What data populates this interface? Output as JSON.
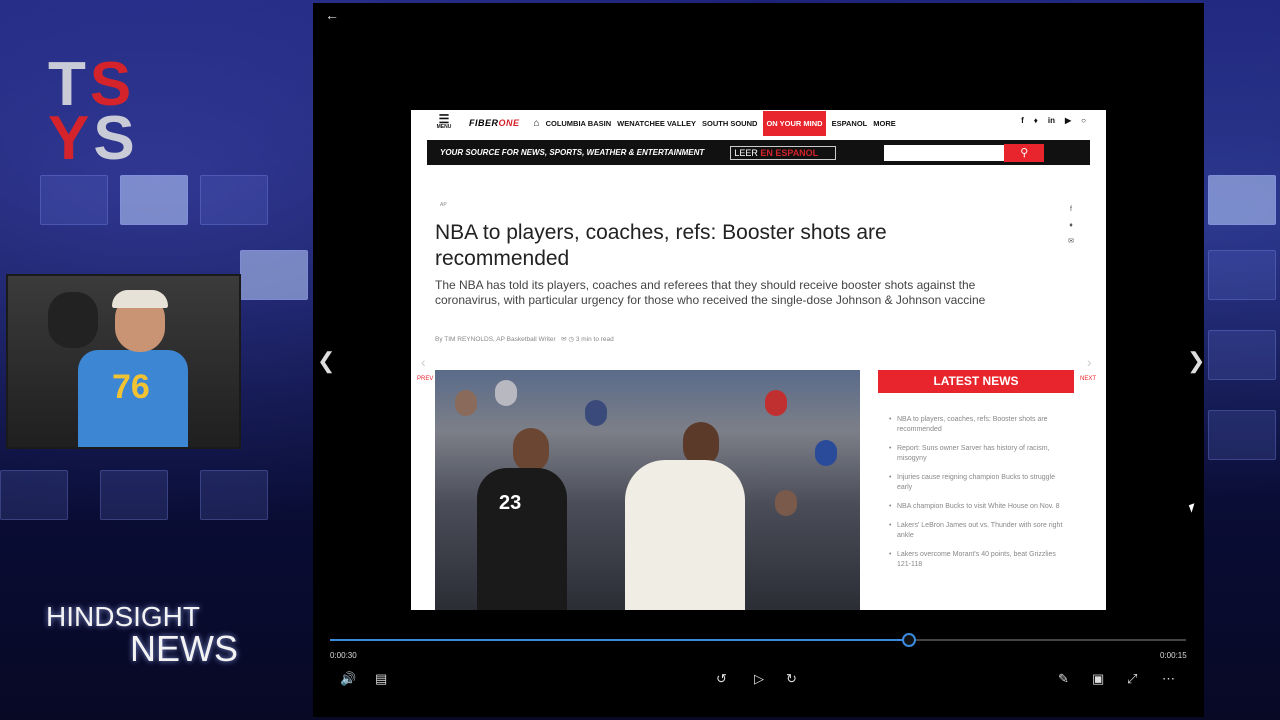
{
  "overlay": {
    "logo_line1_a": "T",
    "logo_line1_b": "S",
    "logo_line2_a": "Y",
    "logo_line2_b": "S",
    "show_word1": "HINDSIGHT",
    "show_word2": "NEWS",
    "shirt_number": "76"
  },
  "site": {
    "menu_label": "MENU",
    "brand_a": "FIBER",
    "brand_b": "ONE",
    "nav": [
      "COLUMBIA BASIN",
      "WENATCHEE VALLEY",
      "SOUTH SOUND",
      "ON YOUR MIND",
      "ESPANOL",
      "MORE"
    ],
    "tagline": "YOUR SOURCE FOR NEWS, SPORTS, WEATHER & ENTERTAINMENT",
    "leer_a": "LEER",
    "leer_b": "EN ESPANOL"
  },
  "article": {
    "source": "AP",
    "title": "NBA to players, coaches, refs: Booster shots are recommended",
    "summary": "The NBA has told its players, coaches and referees that they should receive booster shots against the coronavirus, with particular urgency for those who received the single-dose Johnson & Johnson vaccine",
    "byline": "By TIM REYNOLDS, AP Basketball Writer",
    "read_time": "3 min to read",
    "jersey_number": "23"
  },
  "pager": {
    "prev": "PREV",
    "next": "NEXT"
  },
  "latest": {
    "heading": "LATEST NEWS",
    "items": [
      "NBA to players, coaches, refs: Booster shots are recommended",
      "Report: Suns owner Sarver has history of racism, misogyny",
      "Injuries cause reigning champion Bucks to struggle early",
      "NBA champion Bucks to visit White House on Nov. 8",
      "Lakers' LeBron James out vs. Thunder with sore right ankle",
      "Lakers overcome Morant's 40 points, beat Grizzlies 121-118"
    ]
  },
  "player": {
    "time_elapsed": "0:00:30",
    "time_remaining": "0:00:15",
    "progress": 0.675
  },
  "colors": {
    "accent_red": "#e8242c",
    "scrub_blue": "#3a8be0"
  }
}
